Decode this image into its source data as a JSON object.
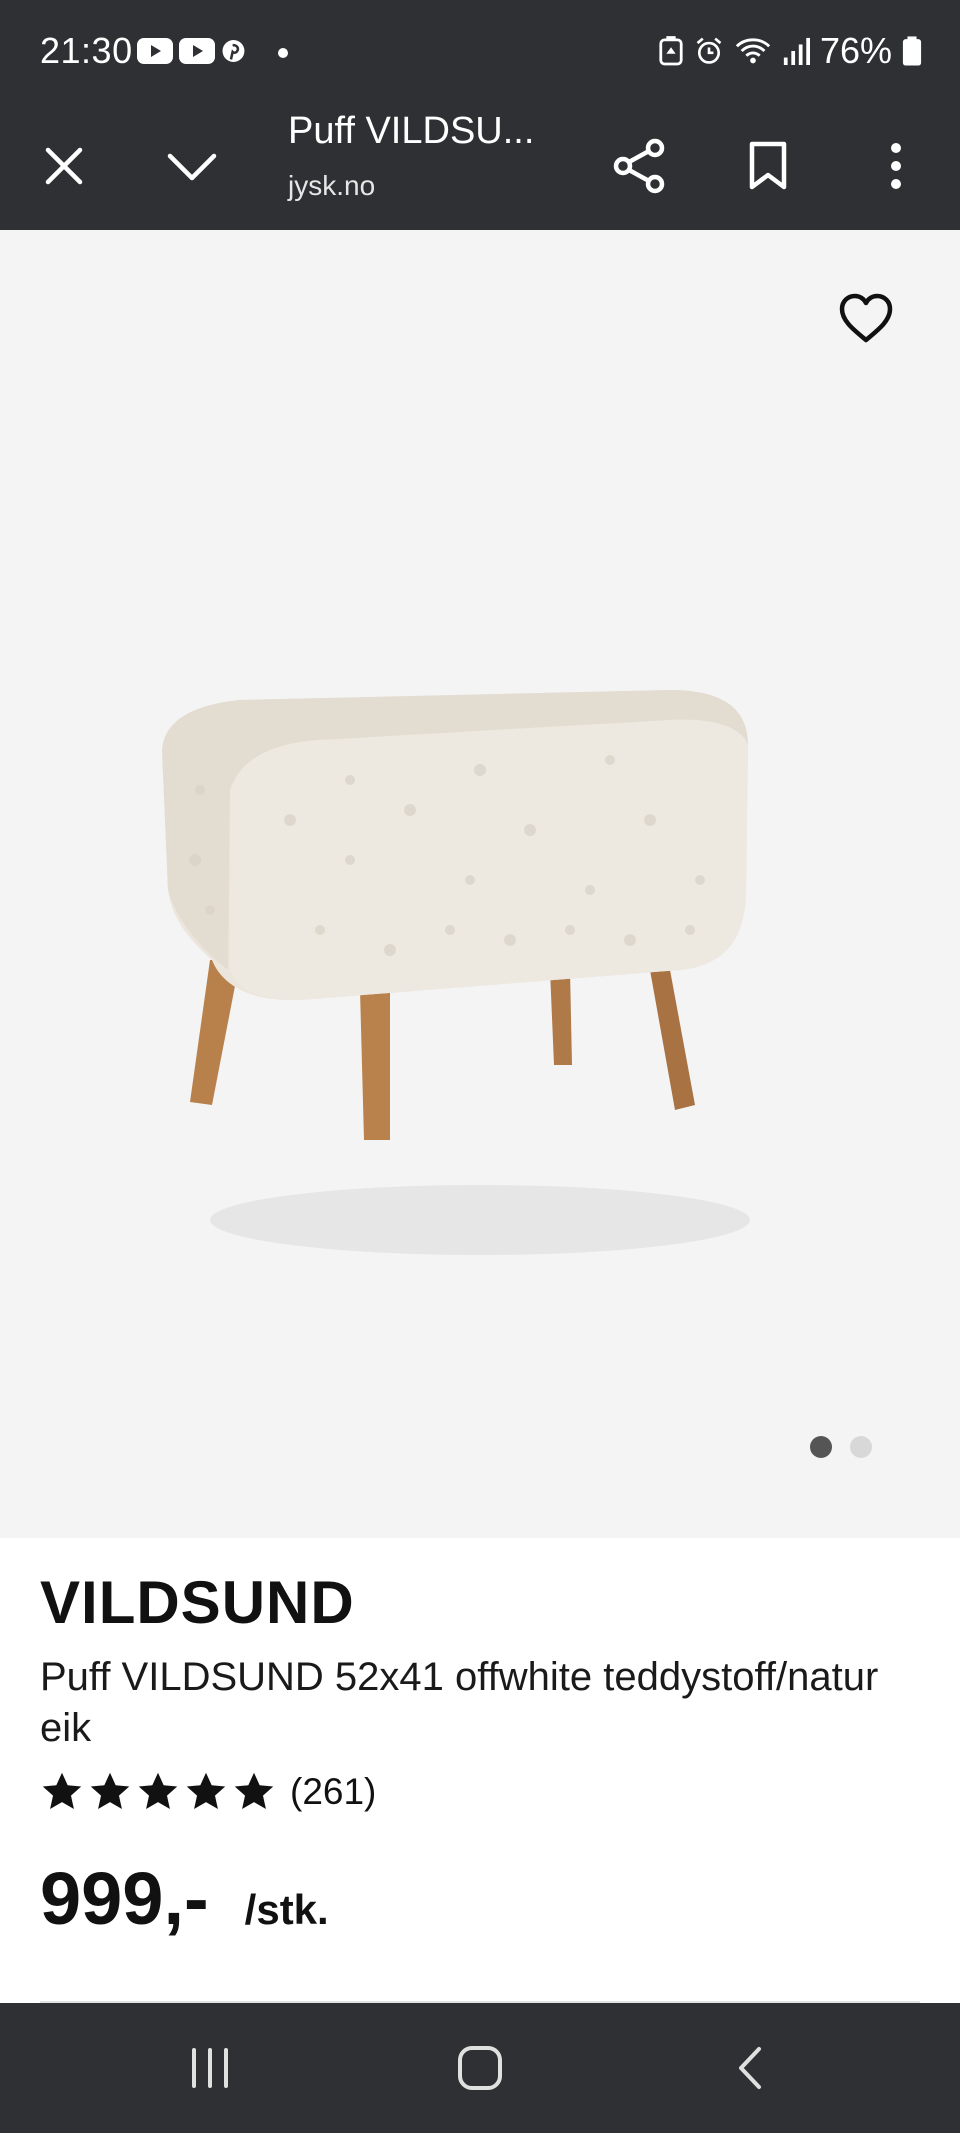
{
  "status_bar": {
    "time": "21:30",
    "app_icons": [
      "youtube-icon",
      "youtube-icon",
      "pinterest-icon"
    ],
    "system_icons": [
      "battery-saver-icon",
      "alarm-icon",
      "wifi-icon",
      "signal-icon",
      "battery-icon"
    ],
    "battery_percent": "76%"
  },
  "toolbar": {
    "title": "Puff VILDSU...",
    "url": "jysk.no",
    "icons": [
      "close-icon",
      "chevron-down-icon",
      "share-icon",
      "bookmark-icon",
      "more-vert-icon"
    ]
  },
  "gallery": {
    "favorite_icon": "heart-outline-icon",
    "image_count": 2,
    "active_index": 0,
    "image_alt": "Puff VILDSUND"
  },
  "product": {
    "brand": "VILDSUND",
    "description": "Puff VILDSUND 52x41 offwhite teddystoff/natur eik",
    "rating": 5,
    "rating_max": 5,
    "review_count": "(261)",
    "price": "999,-",
    "unit": "/stk."
  },
  "nav_bar": {
    "icons": [
      "recents-icon",
      "home-icon",
      "back-icon"
    ]
  },
  "colors": {
    "bar_background": "#2f3033",
    "image_background": "#f4f4f4",
    "text": "#111111",
    "dot_active": "#555555",
    "dot_inactive": "#d8d8d8"
  }
}
